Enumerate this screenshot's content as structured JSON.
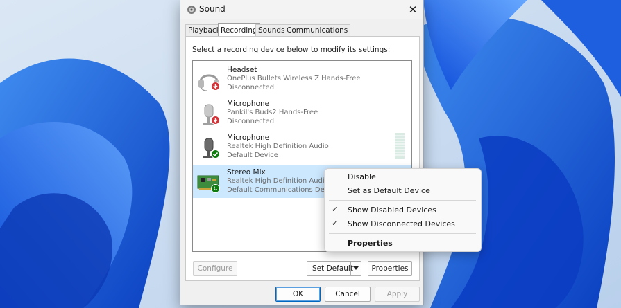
{
  "window": {
    "title": "Sound",
    "close_glyph": "✕"
  },
  "tabs": [
    {
      "label": "Playback",
      "active": false
    },
    {
      "label": "Recording",
      "active": true
    },
    {
      "label": "Sounds",
      "active": false
    },
    {
      "label": "Communications",
      "active": false
    }
  ],
  "instruction": "Select a recording device below to modify its settings:",
  "devices": [
    {
      "name": "Headset",
      "description": "OnePlus Bullets Wireless Z Hands-Free",
      "status": "Disconnected",
      "icon": "headset-icon",
      "badge": "disconnected-badge-icon"
    },
    {
      "name": "Microphone",
      "description": "Pankil's Buds2 Hands-Free",
      "status": "Disconnected",
      "icon": "microphone-icon",
      "badge": "disconnected-badge-icon"
    },
    {
      "name": "Microphone",
      "description": "Realtek High Definition Audio",
      "status": "Default Device",
      "icon": "microphone-icon",
      "badge": "default-check-badge-icon"
    },
    {
      "name": "Stereo Mix",
      "description": "Realtek High Definition Audio",
      "status": "Default Communications Device",
      "icon": "sound-card-icon",
      "badge": "default-comm-badge-icon",
      "selected": true
    }
  ],
  "buttons": {
    "configure": "Configure",
    "set_default": "Set Default",
    "properties": "Properties",
    "ok": "OK",
    "cancel": "Cancel",
    "apply": "Apply"
  },
  "context_menu": {
    "disable": "Disable",
    "set_default_device": "Set as Default Device",
    "show_disabled": "Show Disabled Devices",
    "show_disconnected": "Show Disconnected Devices",
    "properties": "Properties",
    "show_disabled_checked": true,
    "show_disconnected_checked": true
  },
  "colors": {
    "accent": "#0067c0",
    "selection": "#cce8ff",
    "disconnected_badge": "#d13438",
    "default_badge": "#107c10"
  }
}
